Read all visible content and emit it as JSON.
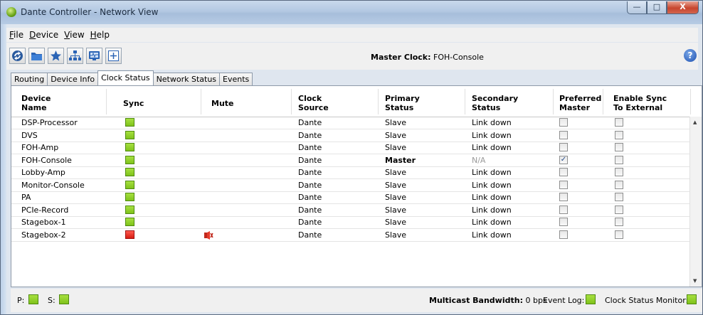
{
  "window": {
    "title": "Dante Controller - Network View",
    "buttons": {
      "minimize": "—",
      "maximize": "□",
      "close": "X"
    }
  },
  "menu": [
    {
      "key": "F",
      "rest": "ile"
    },
    {
      "key": "D",
      "rest": "evice"
    },
    {
      "key": "V",
      "rest": "iew"
    },
    {
      "key": "H",
      "rest": "elp"
    }
  ],
  "toolbar": {
    "icons": [
      "refresh-icon",
      "folder-icon",
      "star-icon",
      "network-icon",
      "monitor-icon",
      "add-icon"
    ],
    "master_clock_label": "Master Clock:",
    "master_clock_value": "FOH-Console",
    "help": "?"
  },
  "tabs": [
    "Routing",
    "Device Info",
    "Clock Status",
    "Network Status",
    "Events"
  ],
  "active_tab": "Clock Status",
  "columns": {
    "device_name": [
      "Device",
      "Name"
    ],
    "sync": [
      "Sync"
    ],
    "mute": [
      "Mute"
    ],
    "clock_source": [
      "Clock",
      "Source"
    ],
    "primary_status": [
      "Primary",
      "Status"
    ],
    "secondary_status": [
      "Secondary",
      "Status"
    ],
    "preferred_master": [
      "Preferred",
      "Master"
    ],
    "enable_sync": [
      "Enable Sync",
      "To External"
    ]
  },
  "rows": [
    {
      "device": "DSP-Processor",
      "sync": "green",
      "mute": false,
      "clock_source": "Dante",
      "primary": "Slave",
      "secondary": "Link down",
      "preferred_master": false,
      "enable_sync": false
    },
    {
      "device": "DVS",
      "sync": "green",
      "mute": false,
      "clock_source": "Dante",
      "primary": "Slave",
      "secondary": "Link down",
      "preferred_master": false,
      "enable_sync": false
    },
    {
      "device": "FOH-Amp",
      "sync": "green",
      "mute": false,
      "clock_source": "Dante",
      "primary": "Slave",
      "secondary": "Link down",
      "preferred_master": false,
      "enable_sync": false
    },
    {
      "device": "FOH-Console",
      "sync": "green",
      "mute": false,
      "clock_source": "Dante",
      "primary": "Master",
      "secondary": "N/A",
      "preferred_master": true,
      "enable_sync": false
    },
    {
      "device": "Lobby-Amp",
      "sync": "green",
      "mute": false,
      "clock_source": "Dante",
      "primary": "Slave",
      "secondary": "Link down",
      "preferred_master": false,
      "enable_sync": false
    },
    {
      "device": "Monitor-Console",
      "sync": "green",
      "mute": false,
      "clock_source": "Dante",
      "primary": "Slave",
      "secondary": "Link down",
      "preferred_master": false,
      "enable_sync": false
    },
    {
      "device": "PA",
      "sync": "green",
      "mute": false,
      "clock_source": "Dante",
      "primary": "Slave",
      "secondary": "Link down",
      "preferred_master": false,
      "enable_sync": false
    },
    {
      "device": "PCIe-Record",
      "sync": "green",
      "mute": false,
      "clock_source": "Dante",
      "primary": "Slave",
      "secondary": "Link down",
      "preferred_master": false,
      "enable_sync": false
    },
    {
      "device": "Stagebox-1",
      "sync": "green",
      "mute": false,
      "clock_source": "Dante",
      "primary": "Slave",
      "secondary": "Link down",
      "preferred_master": false,
      "enable_sync": false
    },
    {
      "device": "Stagebox-2",
      "sync": "red",
      "mute": true,
      "clock_source": "Dante",
      "primary": "Slave",
      "secondary": "Link down",
      "preferred_master": false,
      "enable_sync": false
    }
  ],
  "status_bar": {
    "p_label": "P:",
    "s_label": "S:",
    "bandwidth_label": "Multicast Bandwidth:",
    "bandwidth_value": "0 bps",
    "event_log_label": "Event Log:",
    "clock_monitor_label": "Clock Status Monitor:"
  },
  "colors": {
    "sync_ok": "#8fd12a",
    "sync_error": "#e8281e",
    "titlebar": "#b9cde6"
  }
}
